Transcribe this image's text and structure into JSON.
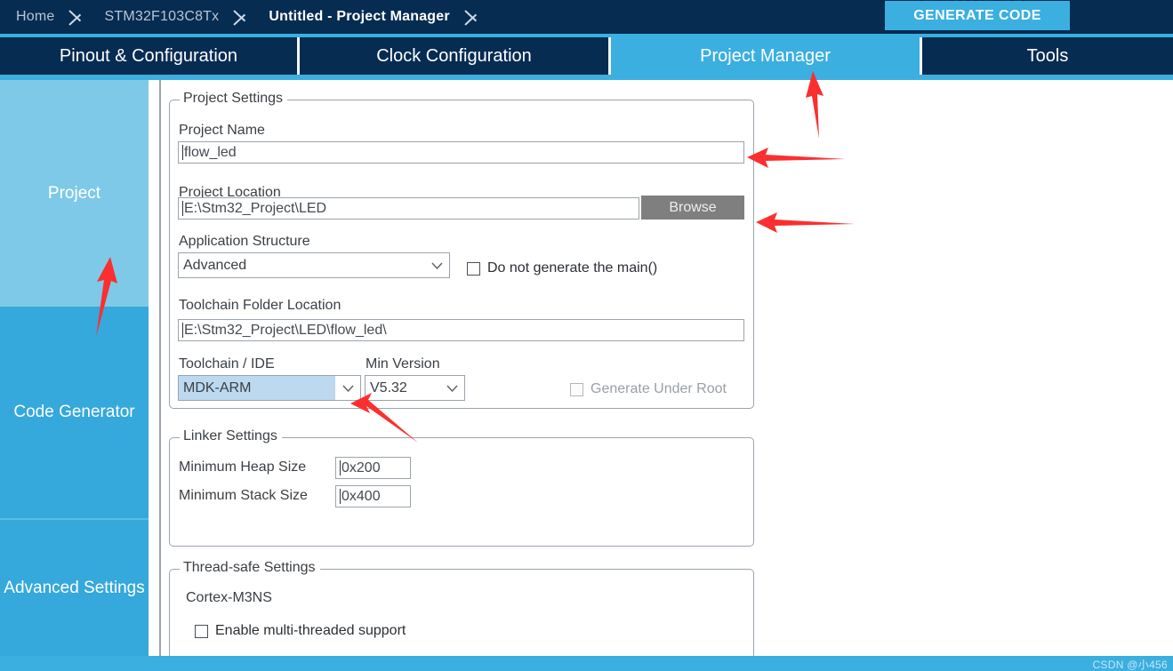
{
  "breadcrumb": {
    "items": [
      {
        "label": "Home",
        "active": false
      },
      {
        "label": "STM32F103C8Tx",
        "active": false
      },
      {
        "label": "Untitled - Project Manager",
        "active": true
      }
    ]
  },
  "header": {
    "generate_code_label": "GENERATE CODE",
    "accent_color": "#3bafe0",
    "bar_color": "#062c52"
  },
  "tabs": [
    {
      "label": "Pinout & Configuration",
      "active": false
    },
    {
      "label": "Clock Configuration",
      "active": false
    },
    {
      "label": "Project Manager",
      "active": true
    },
    {
      "label": "Tools",
      "active": false
    }
  ],
  "sidebar": {
    "items": [
      {
        "label": "Project",
        "active": true
      },
      {
        "label": "Code Generator",
        "active": false
      },
      {
        "label": "Advanced Settings",
        "active": false
      }
    ]
  },
  "project_settings": {
    "title": "Project Settings",
    "project_name": {
      "label": "Project Name",
      "value": "flow_led",
      "placeholder": ""
    },
    "project_location": {
      "label": "Project Location",
      "value": "E:\\Stm32_Project\\LED",
      "placeholder": "",
      "browse_label": "Browse"
    },
    "application_structure": {
      "label": "Application Structure",
      "value": "Advanced"
    },
    "do_not_generate_main": {
      "label": "Do not generate the main()",
      "checked": false
    },
    "toolchain_folder_location": {
      "label": "Toolchain Folder Location",
      "value": "E:\\Stm32_Project\\LED\\flow_led\\",
      "placeholder": ""
    },
    "toolchain_ide": {
      "label": "Toolchain / IDE",
      "value": "MDK-ARM",
      "highlighted": true
    },
    "min_version": {
      "label": "Min Version",
      "value": "V5.32"
    },
    "generate_under_root": {
      "label": "Generate Under Root",
      "checked": false,
      "disabled": true
    }
  },
  "linker_settings": {
    "title": "Linker Settings",
    "minimum_heap_size": {
      "label": "Minimum Heap Size",
      "value": "0x200"
    },
    "minimum_stack_size": {
      "label": "Minimum Stack Size",
      "value": "0x400"
    }
  },
  "thread_safe_settings": {
    "title": "Thread-safe Settings",
    "core_label": "Cortex-M3NS",
    "enable_multi_threaded": {
      "label": "Enable multi-threaded support",
      "checked": false
    }
  },
  "footer": {
    "watermark": "CSDN @小456"
  },
  "icons": {
    "chevron_right": "chevron-right-icon",
    "chevron_down": "chevron-down-icon"
  }
}
